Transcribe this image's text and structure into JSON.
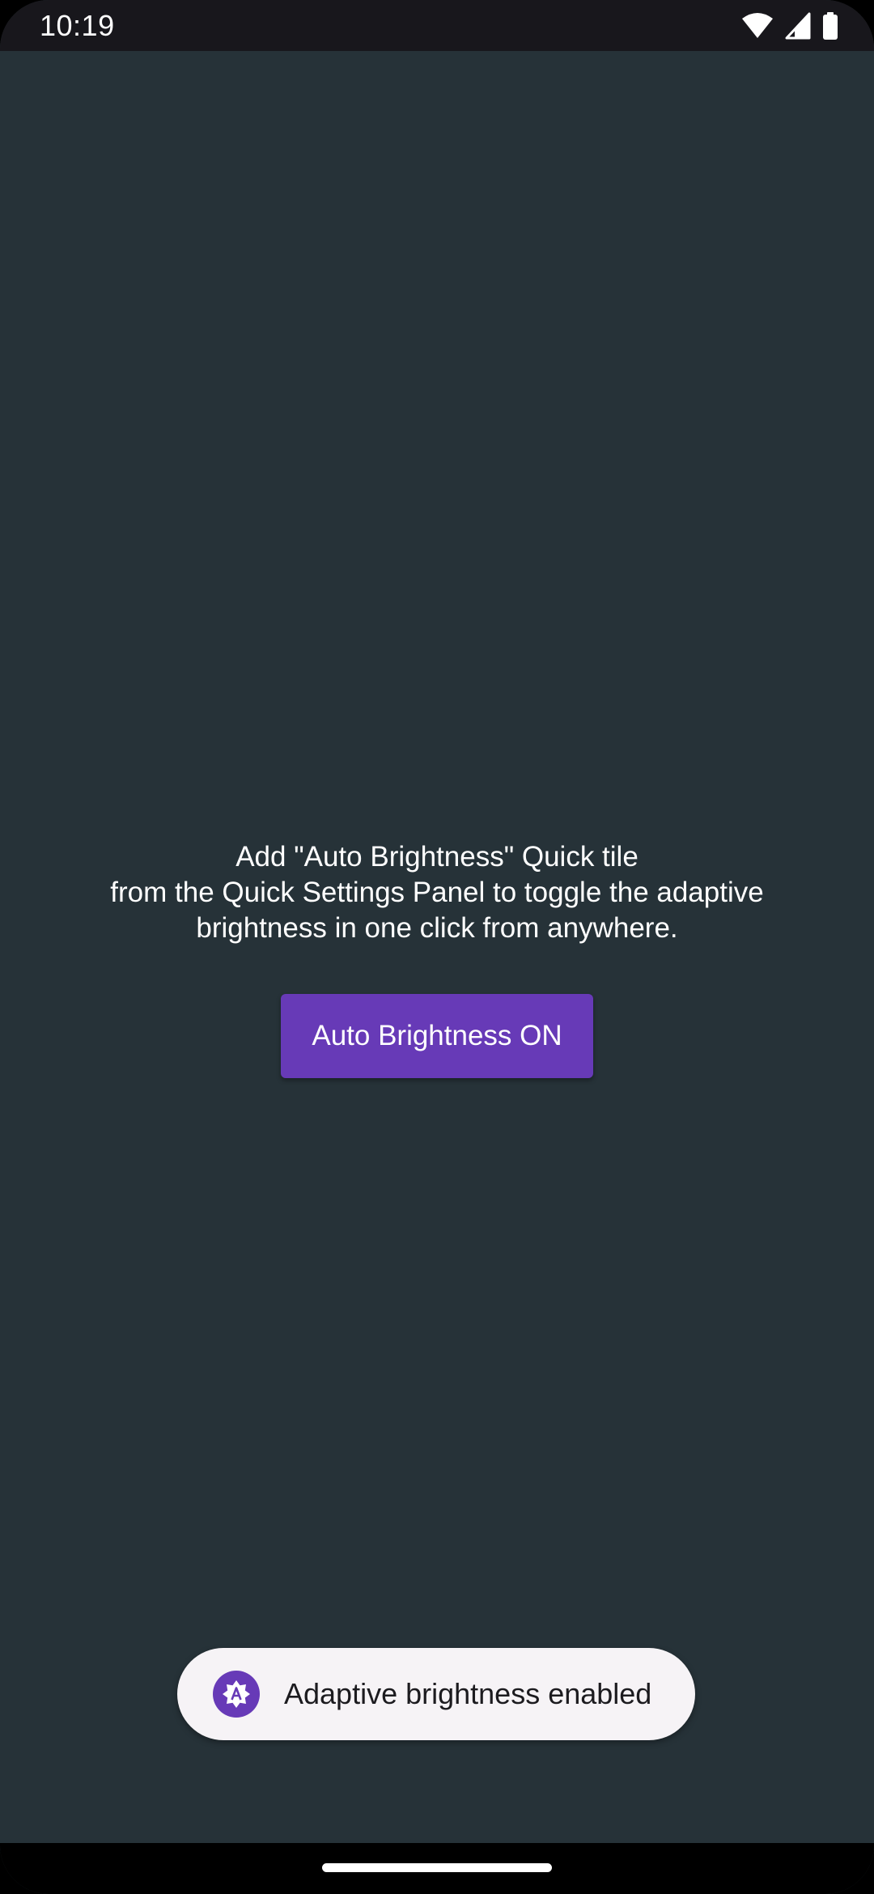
{
  "status_bar": {
    "time": "10:19",
    "icons": [
      "wifi-icon",
      "cellular-signal-icon",
      "battery-icon"
    ]
  },
  "main": {
    "instructions": [
      "Add \"Auto Brightness\" Quick tile",
      "from the Quick Settings Panel to toggle the adaptive",
      "brightness in one click from anywhere."
    ],
    "button_label": "Auto Brightness ON"
  },
  "toast": {
    "icon": "adaptive-brightness-icon",
    "text": "Adaptive brightness enabled"
  },
  "colors": {
    "background": "#263238",
    "accent": "#673ab7",
    "status_bar": "#18171c",
    "toast_background": "#f6f3f6"
  }
}
